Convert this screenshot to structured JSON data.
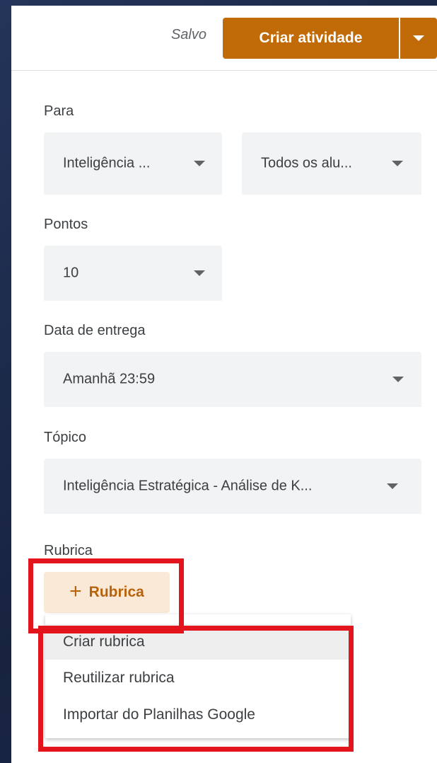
{
  "header": {
    "saved_status": "Salvo",
    "create_button_label": "Criar atividade"
  },
  "form": {
    "for": {
      "label": "Para",
      "class_value": "Inteligência ...",
      "students_value": "Todos os alu..."
    },
    "points": {
      "label": "Pontos",
      "value": "10"
    },
    "due_date": {
      "label": "Data de entrega",
      "value": "Amanhã 23:59"
    },
    "topic": {
      "label": "Tópico",
      "value": "Inteligência Estratégica - Análise de K..."
    },
    "rubric": {
      "label": "Rubrica",
      "button_icon": "+",
      "button_label": "Rubrica"
    }
  },
  "rubric_menu": {
    "items": [
      {
        "label": "Criar rubrica"
      },
      {
        "label": "Reutilizar rubrica"
      },
      {
        "label": "Importar do Planilhas Google"
      }
    ]
  },
  "colors": {
    "accent": "#c16a08",
    "highlight": "#e3141b",
    "field_background": "#f1f3f4"
  }
}
